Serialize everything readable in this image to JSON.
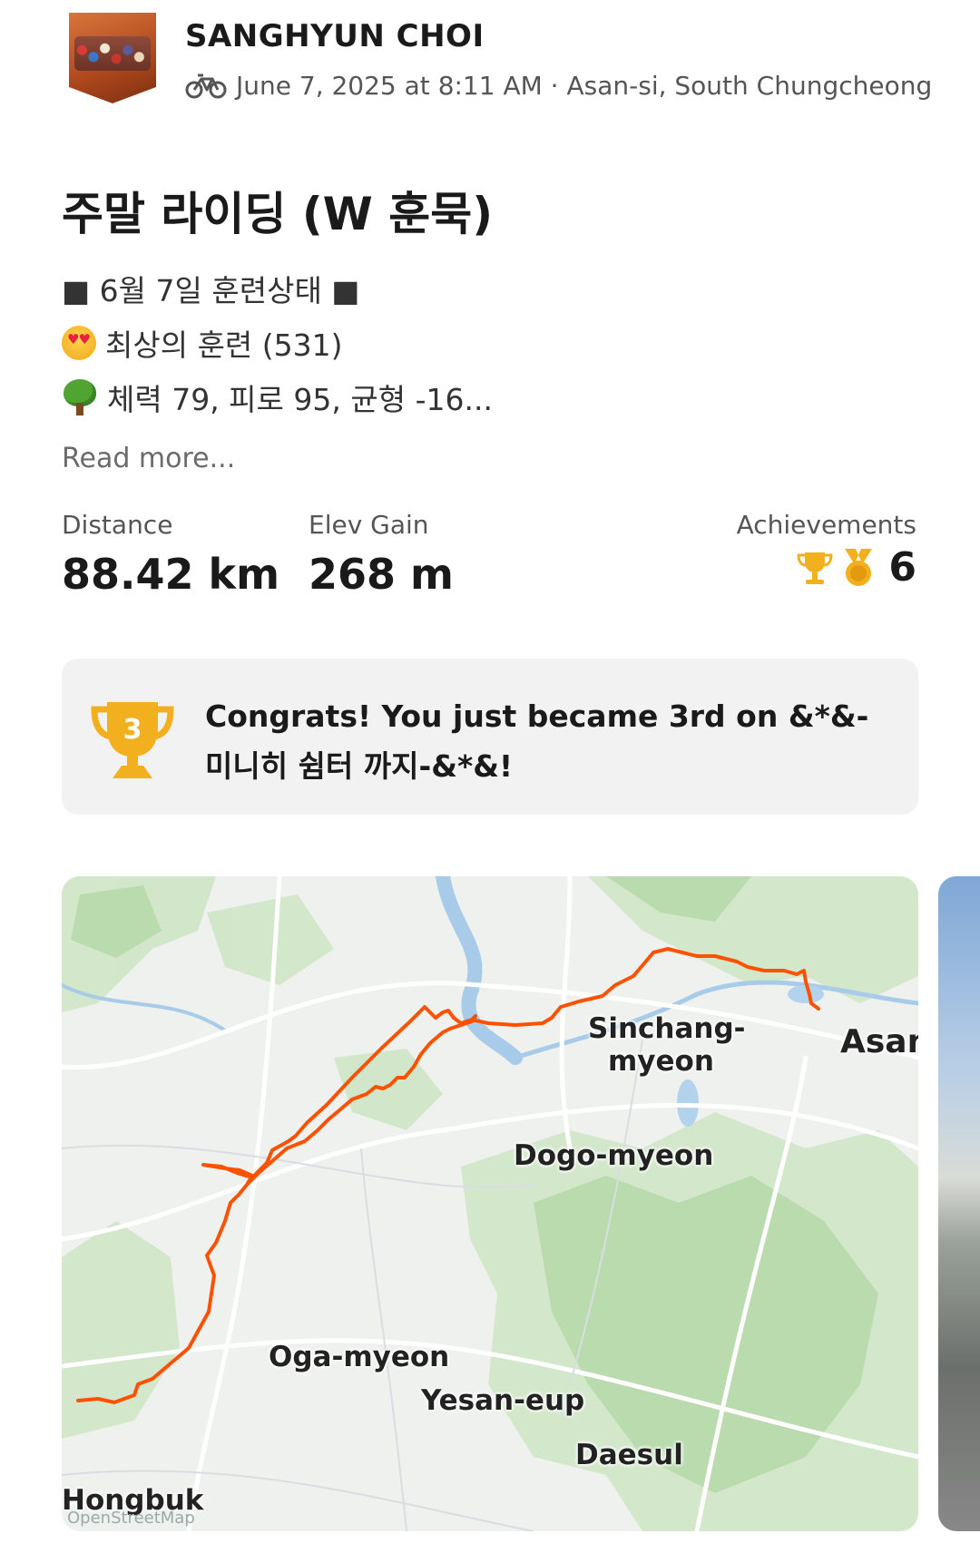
{
  "header": {
    "athlete_name": "SANGHYUN CHOI",
    "activity_icon": "bike-icon",
    "datetime_location": "June 7, 2025 at 8:11 AM · Asan-si, South Chungcheong"
  },
  "activity": {
    "title": "주말 라이딩 (W 훈묵)",
    "description_lines": [
      "■ 6월 7일 훈련상태 ■",
      "최상의 훈련 (531)",
      "체력 79, 피로 95, 균형 -16..."
    ],
    "read_more": "Read more..."
  },
  "stats": {
    "distance_label": "Distance",
    "distance_value": "88.42 km",
    "elev_label": "Elev Gain",
    "elev_value": "268 m",
    "achievements_label": "Achievements",
    "achievements_count": "6"
  },
  "congrats": {
    "rank_badge": "3",
    "message": "Congrats! You just became 3rd on &*&-미니히 쉼터 까지-&*&!"
  },
  "map": {
    "labels": {
      "sinchang": "Sinchang-",
      "sinchang2": "myeon",
      "asan": "Asan",
      "dogo": "Dogo-myeon",
      "oga": "Oga-myeon",
      "yesan": "Yesan-eup",
      "daesul": "Daesul",
      "hongbuk": "Hongbuk",
      "attribution": "OpenStreetMap"
    },
    "route_color": "#fc5200"
  }
}
